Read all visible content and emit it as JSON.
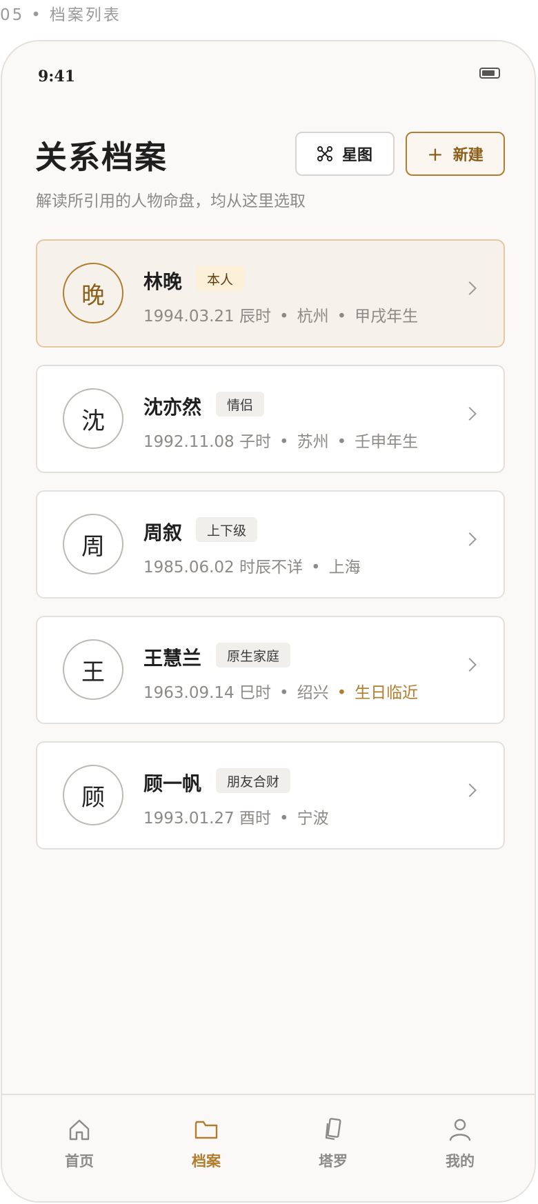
{
  "caption": {
    "index": "05",
    "separator": "•",
    "title": "档案列表"
  },
  "status_bar": {
    "time": "9:41"
  },
  "header": {
    "title": "关系档案",
    "subtitle": "解读所引用的人物命盘，均从这里选取",
    "star_button": "星图",
    "new_button": "新建",
    "new_button_icon": "+"
  },
  "profiles": [
    {
      "initial": "晚",
      "name": "林晚",
      "tag": "本人",
      "date": "1994.03.21 辰时",
      "city": "杭州",
      "extra": "甲戌年生"
    },
    {
      "initial": "沈",
      "name": "沈亦然",
      "tag": "情侣",
      "date": "1992.11.08 子时",
      "city": "苏州",
      "extra": "壬申年生"
    },
    {
      "initial": "周",
      "name": "周叙",
      "tag": "上下级",
      "date": "1985.06.02 时辰不详",
      "city": "上海"
    },
    {
      "initial": "王",
      "name": "王慧兰",
      "tag": "原生家庭",
      "date": "1963.09.14 巳时",
      "city": "绍兴",
      "extra": "生日临近"
    },
    {
      "initial": "顾",
      "name": "顾一帆",
      "tag": "朋友合财",
      "date": "1993.01.27 酉时",
      "city": "宁波"
    }
  ],
  "meta_separator": "•",
  "tabs": [
    {
      "label": "首页",
      "icon": "home-icon"
    },
    {
      "label": "档案",
      "icon": "folder-icon"
    },
    {
      "label": "塔罗",
      "icon": "tarot-cards-icon"
    },
    {
      "label": "我的",
      "icon": "user-icon"
    }
  ],
  "colors": {
    "accent": "#b07d2e",
    "active_card_bg": "#f6f1ea",
    "page_bg": "#faf9f7"
  }
}
